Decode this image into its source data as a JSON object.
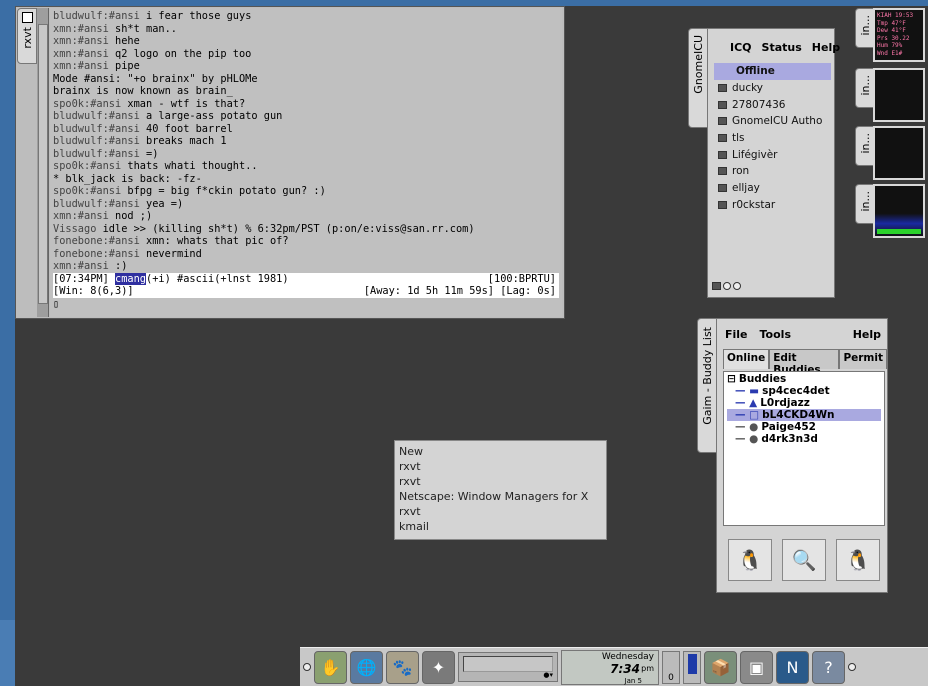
{
  "rxvt": {
    "tab_label": "rxvt",
    "lines": [
      {
        "nick": "bludwulf:#ansi",
        "text": "i fear those guys"
      },
      {
        "nick": "xmn:#ansi",
        "text": "sh*t man.."
      },
      {
        "nick": "xmn:#ansi",
        "text": "hehe"
      },
      {
        "nick": "xmn:#ansi",
        "text": "q2 logo on the pip too"
      },
      {
        "nick": "xmn:#ansi",
        "text": "pipe"
      },
      {
        "nick": "",
        "text": "Mode #ansi: \"+o brainx\" by pHLOMe"
      },
      {
        "nick": "",
        "text": "brainx is now known as brain_"
      },
      {
        "nick": "spo0k:#ansi",
        "text": "xman - wtf is that?"
      },
      {
        "nick": "bludwulf:#ansi",
        "text": "a large-ass potato gun"
      },
      {
        "nick": "bludwulf:#ansi",
        "text": "40 foot barrel"
      },
      {
        "nick": "bludwulf:#ansi",
        "text": "breaks mach 1"
      },
      {
        "nick": "bludwulf:#ansi",
        "text": "=)"
      },
      {
        "nick": "spo0k:#ansi",
        "text": "thats whati thought.."
      },
      {
        "nick": "",
        "text": "* blk_jack is back: -fz-"
      },
      {
        "nick": "spo0k:#ansi",
        "text": "bfpg = big f*ckin potato gun? :)"
      },
      {
        "nick": "bludwulf:#ansi",
        "text": "yea =)"
      },
      {
        "nick": "xmn:#ansi",
        "text": "nod ;)"
      },
      {
        "nick": "Vissago",
        "text": "idle >> (killing sh*t) % 6:32pm/PST (p:on/e:viss@san.rr.com)"
      },
      {
        "nick": "fonebone:#ansi",
        "text": "xmn: whats that pic of?"
      },
      {
        "nick": "fonebone:#ansi",
        "text": "nevermind"
      },
      {
        "nick": "xmn:#ansi",
        "text": ":)"
      }
    ],
    "status1_left": "[07:34PM] ",
    "status1_nick": "cmang",
    "status1_rest": "(+i) #ascii(+lnst 1981)",
    "status1_right": "[100:BPRTU]",
    "status2_left": "[Win: 8(6,3)]",
    "status2_right": "[Away: 1d 5h 11m 59s] [Lag: 0s]"
  },
  "gnomeicu": {
    "tab_label": "GnomeICU",
    "menu": [
      "ICQ",
      "Status",
      "Help"
    ],
    "selected": "Offline",
    "contacts": [
      "ducky",
      "27807436",
      "GnomeICU Autho",
      "tls",
      "Lifégivèr",
      "ron",
      "elljay",
      "r0ckstar"
    ]
  },
  "dock": {
    "labels": [
      "in...",
      "in...",
      "in...",
      "in..."
    ],
    "weather": [
      "KIAH 19:53",
      "Tmp 47°F",
      "Dew 41°F",
      "Prs 30.22",
      "Hum 79%",
      "Wnd E1#"
    ]
  },
  "gaim": {
    "tab_label": "Gaim - Buddy List",
    "menu_file": "File",
    "menu_tools": "Tools",
    "menu_help": "Help",
    "tabs": [
      "Online",
      "Edit Buddies",
      "Permit"
    ],
    "group": "Buddies",
    "buddies": [
      "sp4cec4det",
      "L0rdjazz",
      "bL4CKD4Wn",
      "Paige452",
      "d4rk3n3d"
    ]
  },
  "window_list": [
    "New",
    "rxvt",
    "rxvt",
    "Netscape: Window Managers for X",
    "rxvt",
    "kmail"
  ],
  "panel": {
    "clock_day": "Wednesday",
    "clock_time": "7:34",
    "clock_ampm": "pm",
    "clock_date": "Jan 5",
    "counter": "0"
  }
}
